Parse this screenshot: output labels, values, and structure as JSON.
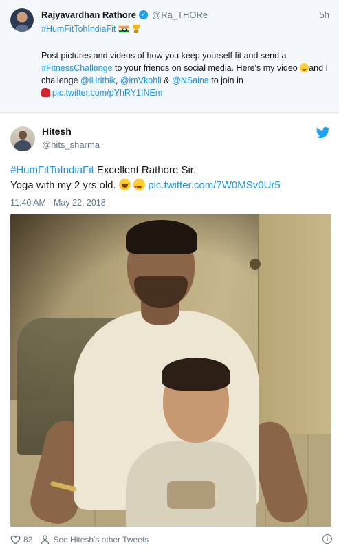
{
  "quoted_tweet": {
    "display_name": "Rajyavardhan Rathore",
    "handle": "@Ra_THORe",
    "time": "5h",
    "hashtag": "#HumFitTohIndiaFit",
    "body_part1": "Post pictures and videos of how you keep yourself fit and send a ",
    "body_hashtag": "#FitnessChallenge",
    "body_part2": " to your friends on social media. Here's my video ",
    "body_part3": "and I challenge ",
    "mention1": "@iHrithik",
    "sep1": ", ",
    "mention2": "@imVkohli",
    "sep2": " & ",
    "mention3": "@NSaina",
    "body_part4": " to join in ",
    "pic_link": "pic.twitter.com/pYhRY1INEm"
  },
  "main_tweet": {
    "display_name": "Hitesh",
    "handle": "@hits_sharma",
    "hashtag": "#HumFitToIndiaFit",
    "text_part1": " Excellent Rathore Sir.",
    "text_part2": "Yoga with my 2 yrs old. ",
    "pic_link": "pic.twitter.com/7W0MSv0Ur5",
    "timestamp": "11:40 AM - May 22, 2018"
  },
  "footer": {
    "like_count": "82",
    "see_other": "See Hitesh's other Tweets"
  },
  "icons": {
    "verified": "verified-badge-icon",
    "twitter": "twitter-bird-icon",
    "like": "heart-icon",
    "profile": "person-icon",
    "info": "info-icon"
  },
  "colors": {
    "link": "#1b95e0",
    "twitter_blue": "#1da1f2",
    "secondary_text": "#657786",
    "quoted_bg": "#f5f8fa"
  }
}
